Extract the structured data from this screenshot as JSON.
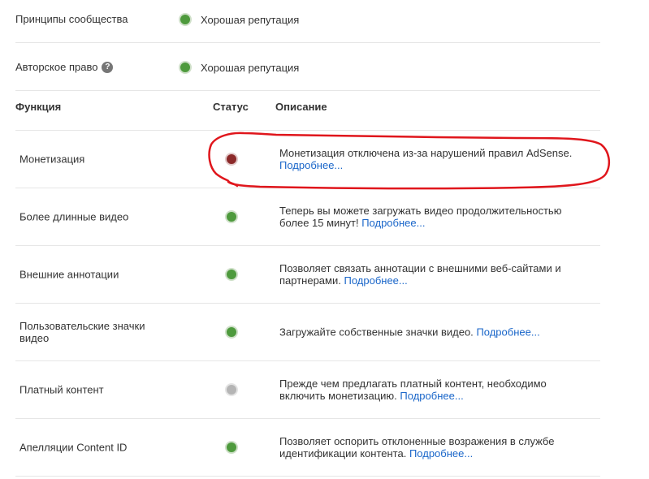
{
  "reputation": [
    {
      "label": "Принципы сообщества",
      "status": "Хорошая репутация",
      "status_color": "#4e9a3d",
      "has_help": false
    },
    {
      "label": "Авторское право",
      "status": "Хорошая репутация",
      "status_color": "#4e9a3d",
      "has_help": true,
      "help_glyph": "?"
    }
  ],
  "table": {
    "headers": {
      "feature": "Функция",
      "status": "Статус",
      "description": "Описание"
    },
    "rows": [
      {
        "feature": "Монетизация",
        "status": "red",
        "desc": "Монетизация отключена из-за нарушений правил AdSense.",
        "link": "Подробнее..."
      },
      {
        "feature": "Более длинные видео",
        "status": "green",
        "desc": "Теперь вы можете загружать видео продолжительностью более 15 минут!",
        "link": "Подробнее..."
      },
      {
        "feature": "Внешние аннотации",
        "status": "green",
        "desc": "Позволяет связать аннотации с внешними веб-сайтами и партнерами.",
        "link": "Подробнее..."
      },
      {
        "feature": "Пользовательские значки видео",
        "status": "green",
        "desc": "Загружайте собственные значки видео.",
        "link": "Подробнее..."
      },
      {
        "feature": "Платный контент",
        "status": "gray",
        "desc": "Прежде чем предлагать платный контент, необходимо включить монетизацию.",
        "link": "Подробнее..."
      },
      {
        "feature": "Апелляции Content ID",
        "status": "green",
        "desc": "Позволяет оспорить отклоненные возражения в службе идентификации контента.",
        "link": "Подробнее..."
      }
    ]
  },
  "colors": {
    "ok": "#4e9a3d",
    "bad": "#8c2a2a",
    "off": "#b5b5b5",
    "link": "#1a66c9",
    "annotation": "#e0161c"
  }
}
